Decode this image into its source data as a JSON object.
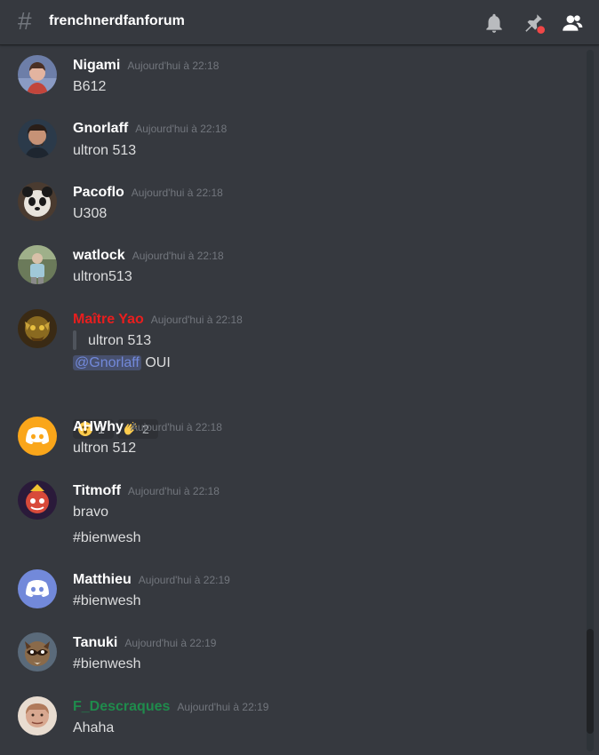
{
  "header": {
    "channel_name": "frenchnerdfanforum",
    "icons": [
      "hash-icon",
      "bell-icon",
      "pin-icon",
      "members-icon"
    ]
  },
  "colors": {
    "background": "#36393f",
    "username_red": "#e91e1e",
    "username_green": "#1f8b4c",
    "mention": "#7289da"
  },
  "messages": [
    {
      "username": "Nigami",
      "timestamp": "Aujourd'hui à 22:18",
      "lines": [
        "B612"
      ]
    },
    {
      "username": "Gnorlaff",
      "timestamp": "Aujourd'hui à 22:18",
      "lines": [
        "ultron 513"
      ]
    },
    {
      "username": "Pacoflo",
      "timestamp": "Aujourd'hui à 22:18",
      "lines": [
        "U308"
      ]
    },
    {
      "username": "watlock",
      "timestamp": "Aujourd'hui à 22:18",
      "lines": [
        "ultron513"
      ]
    },
    {
      "username": "Maître Yao",
      "timestamp": "Aujourd'hui à 22:18",
      "quote": "ultron 513",
      "mention": "@Gnorlaff",
      "reply": "OUI",
      "reactions": [
        {
          "emoji": "surprised-face",
          "count": "1"
        },
        {
          "emoji": "clapping-hands",
          "count": "2"
        }
      ]
    },
    {
      "username": "AHWhy",
      "timestamp": "Aujourd'hui à 22:18",
      "lines": [
        "ultron 512"
      ]
    },
    {
      "username": "Titmoff",
      "timestamp": "Aujourd'hui à 22:18",
      "lines": [
        "bravo",
        "#bienwesh"
      ]
    },
    {
      "username": "Matthieu",
      "timestamp": "Aujourd'hui à 22:19",
      "lines": [
        "#bienwesh"
      ]
    },
    {
      "username": "Tanuki",
      "timestamp": "Aujourd'hui à 22:19",
      "lines": [
        "#bienwesh"
      ]
    },
    {
      "username": "F_Descraques",
      "timestamp": "Aujourd'hui à 22:19",
      "lines": [
        "Ahaha"
      ]
    }
  ]
}
